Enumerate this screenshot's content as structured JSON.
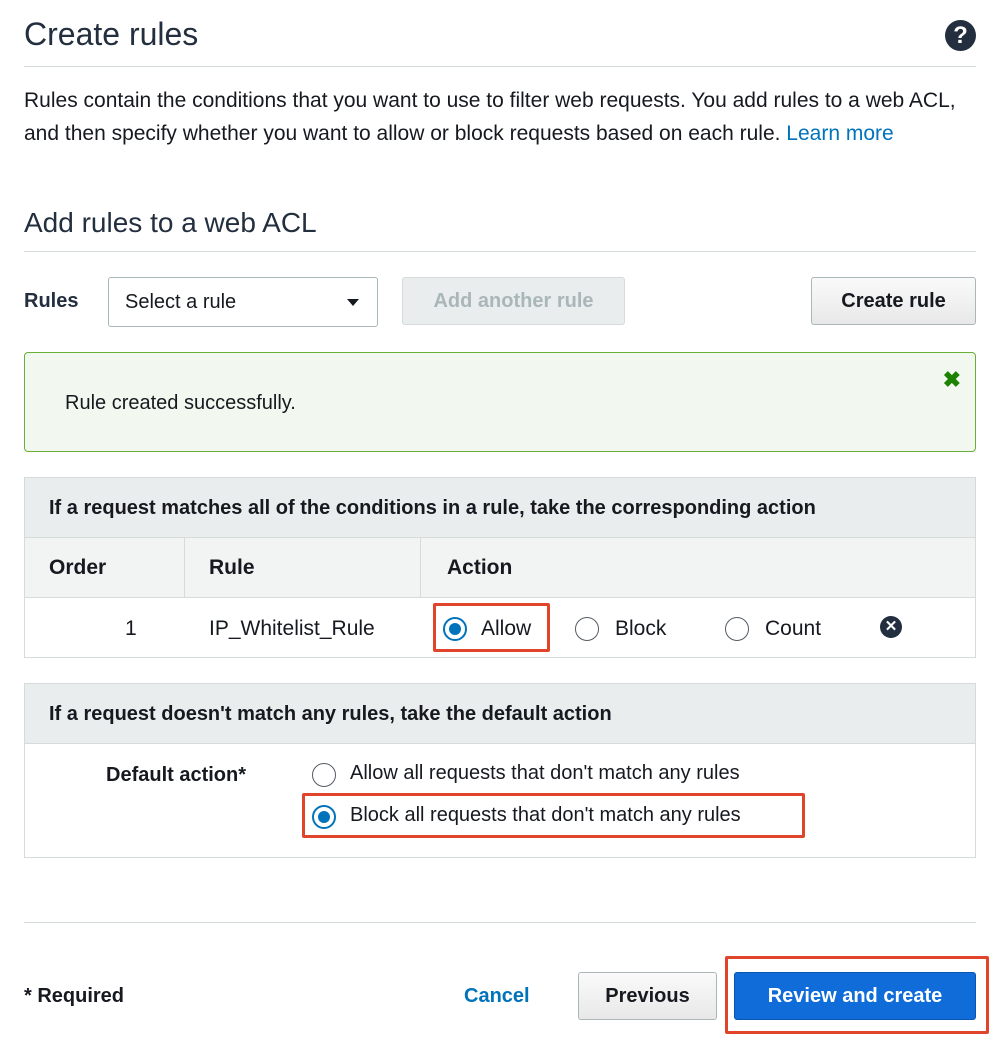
{
  "header": {
    "title": "Create rules",
    "help_icon": "?"
  },
  "intro": {
    "text": "Rules contain the conditions that you want to use to filter web requests. You add rules to a web ACL, and then specify whether you want to allow or block requests based on each rule. ",
    "link_text": "Learn more"
  },
  "section": {
    "title": "Add rules to a web ACL"
  },
  "rules_toolbar": {
    "label": "Rules",
    "select_value": "Select a rule",
    "add_another_label": "Add another rule",
    "create_rule_label": "Create rule"
  },
  "alert": {
    "message": "Rule created successfully.",
    "close_icon": "✖",
    "color": "#1d8102"
  },
  "rules_table": {
    "header": "If a request matches all of the conditions in a rule, take the corresponding action",
    "columns": [
      "Order",
      "Rule",
      "Action"
    ],
    "rows": [
      {
        "order": "1",
        "rule": "IP_Whitelist_Rule",
        "actions": [
          "Allow",
          "Block",
          "Count"
        ],
        "selected_action": "Allow",
        "remove_icon": "✕"
      }
    ]
  },
  "default_action": {
    "header": "If a request doesn't match any rules, take the default action",
    "label": "Default action*",
    "options": [
      "Allow all requests that don't match any rules",
      "Block all requests that don't match any rules"
    ],
    "selected": "Block all requests that don't match any rules"
  },
  "footer": {
    "required_note": "* Required",
    "cancel_label": "Cancel",
    "previous_label": "Previous",
    "review_create_label": "Review and create"
  },
  "colors": {
    "accent": "#0073bb",
    "primary_button": "#0f6cd8",
    "success_border": "#6aaf35",
    "highlight": "#e0452b"
  }
}
